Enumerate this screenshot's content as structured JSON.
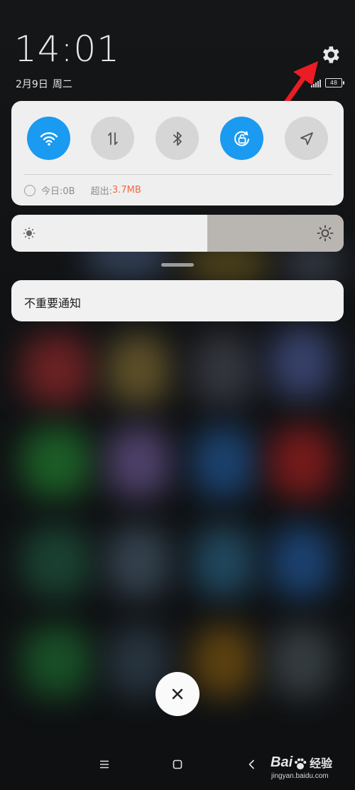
{
  "status": {
    "time": "14:01",
    "date": "2月9日",
    "weekday": "周二",
    "battery": "48",
    "icons": [
      "settings-gear-icon",
      "signal-icon",
      "battery-icon"
    ]
  },
  "quick_settings": {
    "toggles": [
      {
        "name": "wifi",
        "icon": "wifi-icon",
        "on": true
      },
      {
        "name": "mobile-data",
        "icon": "data-arrows-icon",
        "on": false
      },
      {
        "name": "bluetooth",
        "icon": "bluetooth-icon",
        "on": false
      },
      {
        "name": "auto-rotate",
        "icon": "rotation-lock-icon",
        "on": true
      },
      {
        "name": "location",
        "icon": "location-arrow-icon",
        "on": false
      }
    ],
    "data_today_label": "今日:0B",
    "data_over_label": "超出:",
    "data_over_value": "3.7MB",
    "accent_color": "#1a9af0"
  },
  "brightness": {
    "level": 0.59,
    "icons": [
      "brightness-low-icon",
      "brightness-high-icon"
    ]
  },
  "notifications": {
    "items": [
      {
        "label": "不重要通知"
      }
    ]
  },
  "watermark": {
    "brand": "Bai",
    "brand_suffix": "经验",
    "url": "jingyan.baidu.com"
  }
}
